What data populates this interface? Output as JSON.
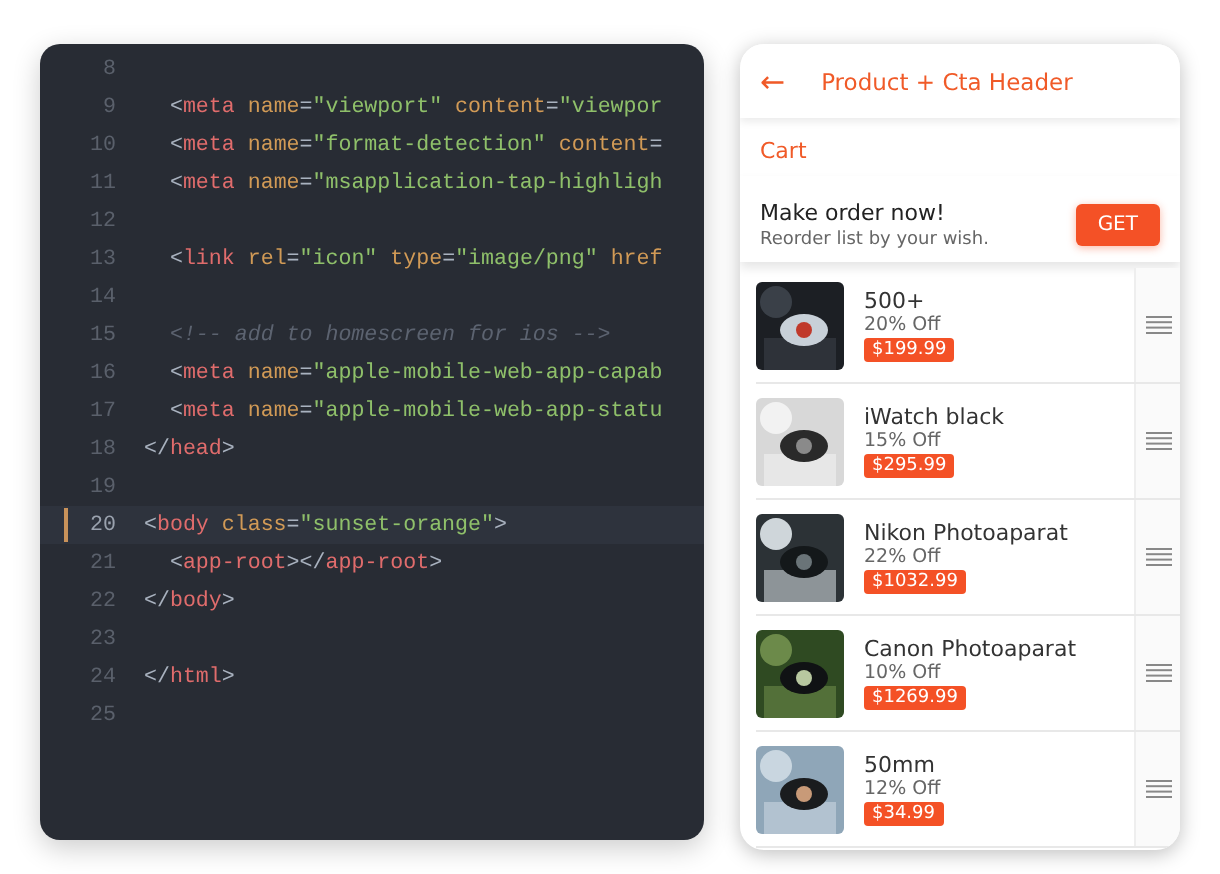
{
  "editor": {
    "lines": [
      {
        "number": "8",
        "current": false
      },
      {
        "number": "9",
        "current": false,
        "tokens": [
          {
            "kind": "punct",
            "text": "  <"
          },
          {
            "kind": "tag",
            "text": "meta"
          },
          {
            "kind": "attr",
            "text": " name"
          },
          {
            "kind": "punct",
            "text": "="
          },
          {
            "kind": "string",
            "text": "\"viewport\""
          },
          {
            "kind": "attr",
            "text": " content"
          },
          {
            "kind": "punct",
            "text": "="
          },
          {
            "kind": "string",
            "text": "\"viewpor"
          }
        ]
      },
      {
        "number": "10",
        "current": false,
        "tokens": [
          {
            "kind": "punct",
            "text": "  <"
          },
          {
            "kind": "tag",
            "text": "meta"
          },
          {
            "kind": "attr",
            "text": " name"
          },
          {
            "kind": "punct",
            "text": "="
          },
          {
            "kind": "string",
            "text": "\"format-detection\""
          },
          {
            "kind": "attr",
            "text": " content"
          },
          {
            "kind": "punct",
            "text": "="
          }
        ]
      },
      {
        "number": "11",
        "current": false,
        "tokens": [
          {
            "kind": "punct",
            "text": "  <"
          },
          {
            "kind": "tag",
            "text": "meta"
          },
          {
            "kind": "attr",
            "text": " name"
          },
          {
            "kind": "punct",
            "text": "="
          },
          {
            "kind": "string",
            "text": "\"msapplication-tap-highligh"
          }
        ]
      },
      {
        "number": "12",
        "current": false
      },
      {
        "number": "13",
        "current": false,
        "tokens": [
          {
            "kind": "punct",
            "text": "  <"
          },
          {
            "kind": "tag",
            "text": "link"
          },
          {
            "kind": "attr",
            "text": " rel"
          },
          {
            "kind": "punct",
            "text": "="
          },
          {
            "kind": "string",
            "text": "\"icon\""
          },
          {
            "kind": "attr",
            "text": " type"
          },
          {
            "kind": "punct",
            "text": "="
          },
          {
            "kind": "string",
            "text": "\"image/png\""
          },
          {
            "kind": "attr",
            "text": " href"
          }
        ]
      },
      {
        "number": "14",
        "current": false
      },
      {
        "number": "15",
        "current": false,
        "tokens": [
          {
            "kind": "comment",
            "text": "  <!-- add to homescreen for ios -->"
          }
        ]
      },
      {
        "number": "16",
        "current": false,
        "tokens": [
          {
            "kind": "punct",
            "text": "  <"
          },
          {
            "kind": "tag",
            "text": "meta"
          },
          {
            "kind": "attr",
            "text": " name"
          },
          {
            "kind": "punct",
            "text": "="
          },
          {
            "kind": "string",
            "text": "\"apple-mobile-web-app-capab"
          }
        ]
      },
      {
        "number": "17",
        "current": false,
        "tokens": [
          {
            "kind": "punct",
            "text": "  <"
          },
          {
            "kind": "tag",
            "text": "meta"
          },
          {
            "kind": "attr",
            "text": " name"
          },
          {
            "kind": "punct",
            "text": "="
          },
          {
            "kind": "string",
            "text": "\"apple-mobile-web-app-statu"
          }
        ]
      },
      {
        "number": "18",
        "current": false,
        "tokens": [
          {
            "kind": "punct",
            "text": "</"
          },
          {
            "kind": "tag",
            "text": "head"
          },
          {
            "kind": "punct",
            "text": ">"
          }
        ]
      },
      {
        "number": "19",
        "current": false
      },
      {
        "number": "20",
        "current": true,
        "tokens": [
          {
            "kind": "punct",
            "text": "<"
          },
          {
            "kind": "tag",
            "text": "body"
          },
          {
            "kind": "attr",
            "text": " class"
          },
          {
            "kind": "punct",
            "text": "="
          },
          {
            "kind": "string",
            "text": "\"sunset-orange\""
          },
          {
            "kind": "punct",
            "text": ">"
          }
        ]
      },
      {
        "number": "21",
        "current": false,
        "tokens": [
          {
            "kind": "punct",
            "text": "  <"
          },
          {
            "kind": "tag",
            "text": "app-root"
          },
          {
            "kind": "punct",
            "text": "></"
          },
          {
            "kind": "tag",
            "text": "app-root"
          },
          {
            "kind": "punct",
            "text": ">"
          }
        ]
      },
      {
        "number": "22",
        "current": false,
        "tokens": [
          {
            "kind": "punct",
            "text": "</"
          },
          {
            "kind": "tag",
            "text": "body"
          },
          {
            "kind": "punct",
            "text": ">"
          }
        ]
      },
      {
        "number": "23",
        "current": false
      },
      {
        "number": "24",
        "current": false,
        "tokens": [
          {
            "kind": "punct",
            "text": "</"
          },
          {
            "kind": "tag",
            "text": "html"
          },
          {
            "kind": "punct",
            "text": ">"
          }
        ]
      },
      {
        "number": "25",
        "current": false
      }
    ]
  },
  "phone": {
    "header": {
      "back": "←",
      "title": "Product + Cta Header"
    },
    "section": "Cart",
    "banner": {
      "title": "Make order now!",
      "subtitle": "Reorder list by your wish.",
      "button": "GET"
    },
    "items": [
      {
        "name": "500+",
        "discount": "20% Off",
        "price": "$199.99"
      },
      {
        "name": "iWatch black",
        "discount": "15% Off",
        "price": "$295.99"
      },
      {
        "name": "Nikon Photoaparat",
        "discount": "22% Off",
        "price": "$1032.99"
      },
      {
        "name": "Canon Photoaparat",
        "discount": "10% Off",
        "price": "$1269.99"
      },
      {
        "name": "50mm",
        "discount": "12% Off",
        "price": "$34.99"
      }
    ]
  }
}
